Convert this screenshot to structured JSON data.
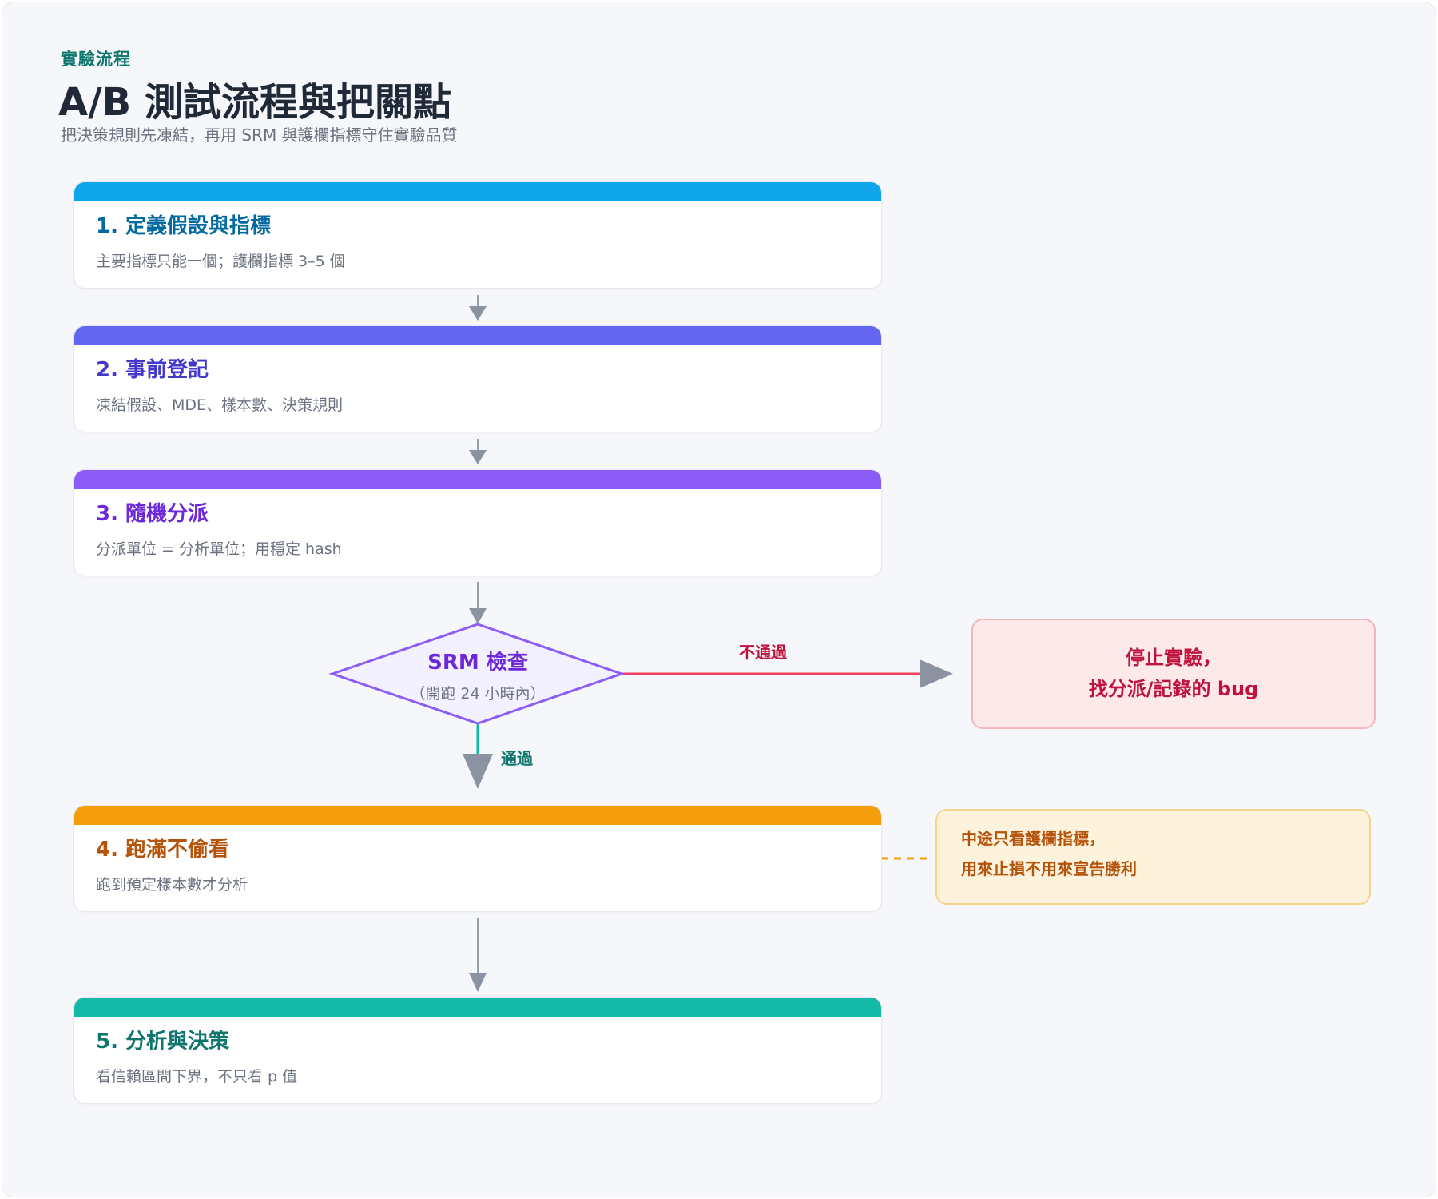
{
  "header": {
    "eyebrow": "實驗流程",
    "title": "A/B 測試流程與把關點",
    "subtitle": "把決策規則先凍結，再用 SRM 與護欄指標守住實驗品質"
  },
  "steps": [
    {
      "title": "1. 定義假設與指標",
      "desc": "主要指標只能一個；護欄指標 3–5 個",
      "color": "#0ea5e9",
      "title_color": "#0369a1"
    },
    {
      "title": "2. 事前登記",
      "desc": "凍結假設、MDE、樣本數、決策規則",
      "color": "#6366f1",
      "title_color": "#4338ca"
    },
    {
      "title": "3. 隨機分派",
      "desc": "分派單位 = 分析單位；用穩定 hash",
      "color": "#8b5cf6",
      "title_color": "#6d28d9"
    },
    {
      "title": "4. 跑滿不偷看",
      "desc": "跑到預定樣本數才分析",
      "color": "#f59e0b",
      "title_color": "#b45309"
    },
    {
      "title": "5. 分析與決策",
      "desc": "看信賴區間下界，不只看 p 值",
      "color": "#14b8a6",
      "title_color": "#0f766e"
    }
  ],
  "decision": {
    "title": "SRM 檢查",
    "subtitle": "（開跑 24 小時內）",
    "fail_label": "不通過",
    "pass_label": "通過"
  },
  "stop_box": {
    "line1": "停止實驗，",
    "line2": "找分派/記錄的 bug"
  },
  "note_box": {
    "line1": "中途只看護欄指標，",
    "line2": "用來止損不用來宣告勝利"
  }
}
